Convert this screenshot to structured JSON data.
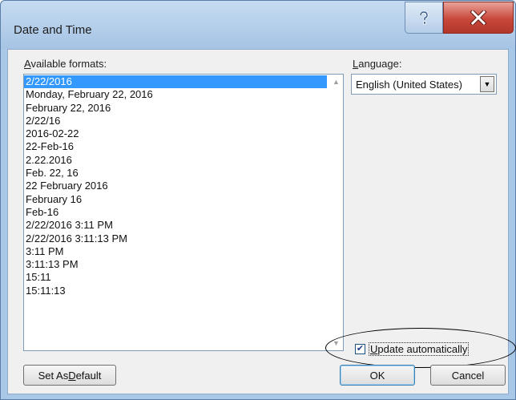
{
  "window": {
    "title": "Date and Time"
  },
  "titlebar_buttons": {
    "help_icon": "help-icon",
    "close_icon": "close-icon"
  },
  "formats": {
    "label_hotkey": "A",
    "label_rest": "vailable formats:",
    "items": [
      "2/22/2016",
      "Monday, February 22, 2016",
      "February 22, 2016",
      "2/22/16",
      "2016-02-22",
      "22-Feb-16",
      "2.22.2016",
      "Feb. 22, 16",
      "22 February 2016",
      "February 16",
      "Feb-16",
      "2/22/2016 3:11 PM",
      "2/22/2016 3:11:13 PM",
      "3:11 PM",
      "3:11:13 PM",
      "15:11",
      "15:11:13"
    ],
    "selected_index": 0
  },
  "language": {
    "label_hotkey": "L",
    "label_rest": "anguage:",
    "value": "English (United States)"
  },
  "update_automatically": {
    "label_hotkey": "U",
    "label_rest": "pdate automatically",
    "checked": true
  },
  "buttons": {
    "set_default_prefix": "Set As ",
    "set_default_hotkey": "D",
    "set_default_rest": "efault",
    "ok": "OK",
    "cancel": "Cancel"
  },
  "colors": {
    "selection": "#3399ff",
    "close_button": "#c8473a",
    "titlebar": "#a9c7e6"
  }
}
